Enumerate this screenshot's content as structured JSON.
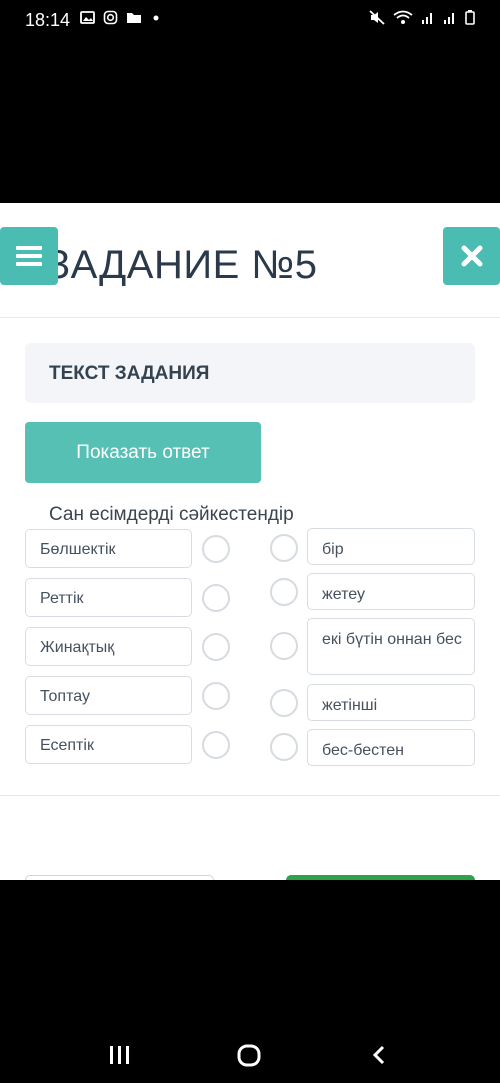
{
  "status_bar": {
    "time": "18:14",
    "left_icons": [
      "image-icon",
      "instagram-icon",
      "folder-icon",
      "dot-icon"
    ],
    "right_icons": [
      "mute-icon",
      "wifi-icon",
      "signal-icon",
      "signal-icon",
      "battery-icon"
    ]
  },
  "header": {
    "title": "ЗАДАНИЕ №5",
    "menu_icon": "hamburger-icon",
    "close_icon": "close-icon"
  },
  "task": {
    "heading": "ТЕКСТ ЗАДАНИЯ",
    "show_answer_label": "Показать ответ",
    "instruction": "Сан есімдерді сәйкестендір"
  },
  "matching": {
    "left_items": [
      "Бөлшектік",
      "Реттік",
      "Жинақтық",
      "Топтау",
      "Есептік"
    ],
    "right_items": [
      "бір",
      "жетеу",
      "екі бүтін оннан бес",
      "жетінші",
      "бес-бестен"
    ]
  },
  "nav_bar": {
    "icons": [
      "recent-apps-icon",
      "home-icon",
      "back-icon"
    ]
  },
  "colors": {
    "accent": "#4bbcb1",
    "button": "#56c0b5",
    "primary_green": "#2fa24c",
    "title_text": "#2b3a4a"
  }
}
